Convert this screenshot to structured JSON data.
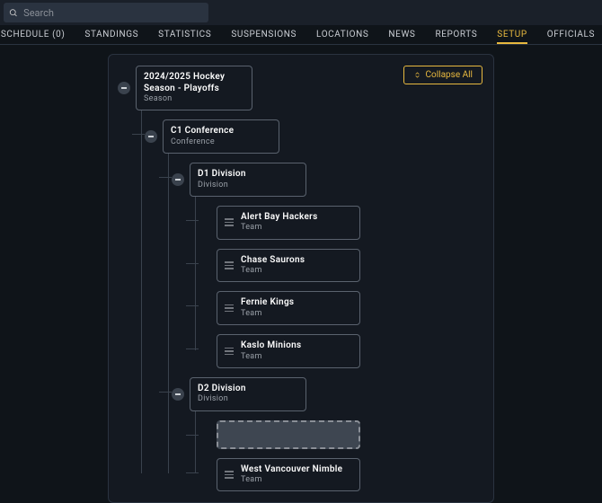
{
  "search": {
    "placeholder": "Search"
  },
  "nav": {
    "items": [
      {
        "label": "SCHEDULE (0)"
      },
      {
        "label": "STANDINGS"
      },
      {
        "label": "STATISTICS"
      },
      {
        "label": "SUSPENSIONS"
      },
      {
        "label": "LOCATIONS"
      },
      {
        "label": "NEWS"
      },
      {
        "label": "REPORTS"
      },
      {
        "label": "SETUP"
      },
      {
        "label": "OFFICIALS"
      }
    ],
    "active_index": 7
  },
  "buttons": {
    "collapse_all": "Collapse All"
  },
  "tree": {
    "season": {
      "title": "2024/2025 Hockey Season - Playoffs",
      "type": "Season"
    },
    "conference": {
      "title": "C1 Conference",
      "type": "Conference"
    },
    "divisions": [
      {
        "title": "D1 Division",
        "type": "Division",
        "teams": [
          {
            "title": "Alert Bay Hackers",
            "type": "Team"
          },
          {
            "title": "Chase Saurons",
            "type": "Team"
          },
          {
            "title": "Fernie Kings",
            "type": "Team"
          },
          {
            "title": "Kaslo Minions",
            "type": "Team"
          }
        ]
      },
      {
        "title": "D2 Division",
        "type": "Division",
        "teams": [
          {
            "title": "West Vancouver Nimble",
            "type": "Team"
          }
        ]
      }
    ]
  }
}
